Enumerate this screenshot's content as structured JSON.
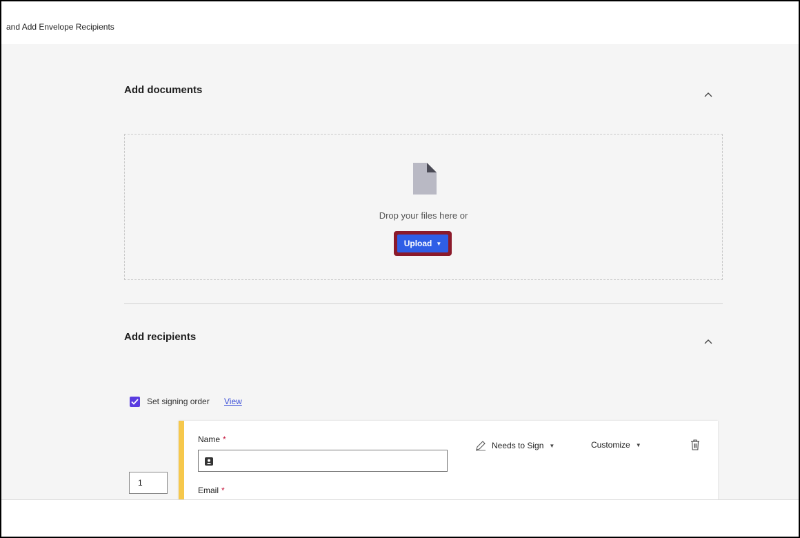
{
  "window": {
    "title": "and Add Envelope Recipients"
  },
  "documents": {
    "title": "Add documents",
    "collapse_icon": "chevron-up-icon",
    "drop_text": "Drop your files here or",
    "upload_label": "Upload",
    "file_icon": "document-icon"
  },
  "recipients": {
    "title": "Add recipients",
    "collapse_icon": "chevron-up-icon",
    "signing_order_label": "Set signing order",
    "signing_order_checked": true,
    "view_link": "View",
    "card": {
      "order": "1",
      "accent_color": "#f6c84c",
      "name_label": "Name",
      "name_value": "",
      "email_label": "Email",
      "required_mark": "*",
      "role_label": "Needs to Sign",
      "customize_label": "Customize"
    }
  },
  "colors": {
    "upload_button": "#2f5ee6",
    "upload_highlight": "#8b1a2b",
    "checkbox": "#5a3de0",
    "link": "#3b4fd8",
    "required": "#c4143b"
  }
}
